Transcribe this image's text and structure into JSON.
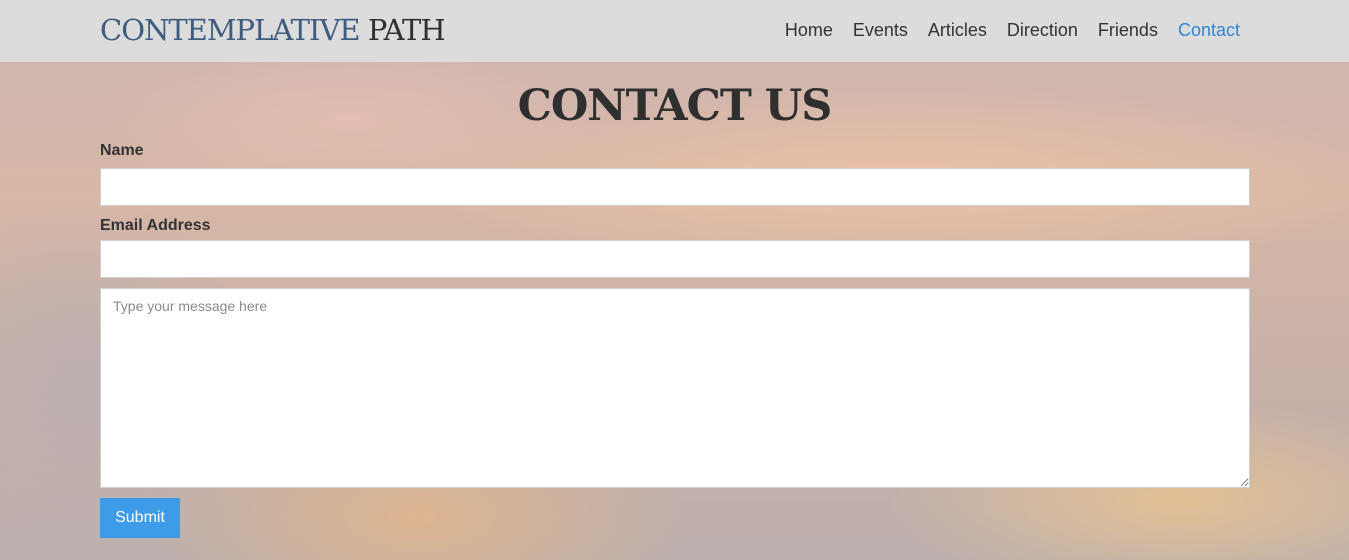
{
  "header": {
    "brand_part1": "CONTEMPLATIVE",
    "brand_part2": "PATH",
    "nav": [
      {
        "label": "Home"
      },
      {
        "label": "Events"
      },
      {
        "label": "Articles"
      },
      {
        "label": "Direction"
      },
      {
        "label": "Friends"
      },
      {
        "label": "Contact",
        "active": true
      }
    ]
  },
  "main": {
    "title": "CONTACT US",
    "form": {
      "name_label": "Name",
      "name_value": "",
      "email_label": "Email Address",
      "email_value": "",
      "message_placeholder": "Type your message here",
      "message_value": "",
      "submit_label": "Submit"
    }
  },
  "colors": {
    "brand_accent": "#3e5c7e",
    "nav_active": "#2f86d6",
    "submit_bg": "#3e9be8",
    "navbar_bg": "#dcdcdc"
  }
}
